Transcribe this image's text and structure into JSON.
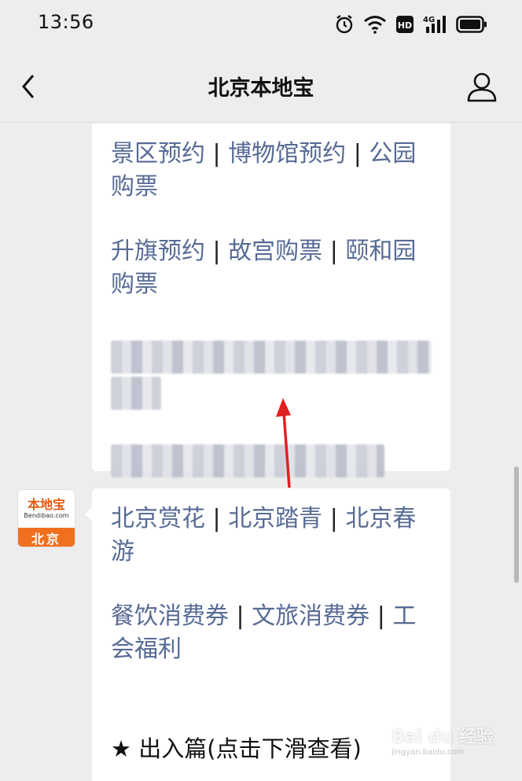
{
  "status_bar": {
    "time": "13:56",
    "network_label": "4G",
    "hd_label": "HD"
  },
  "header": {
    "title": "北京本地宝"
  },
  "message1": {
    "line1": {
      "links": [
        "景区预约",
        "博物馆预约",
        "公园购票"
      ],
      "separator": " | "
    },
    "line2": {
      "links": [
        "升旗预约",
        "故宫购票",
        "颐和园购票"
      ],
      "separator": " | "
    }
  },
  "account": {
    "brand": "本地宝",
    "site": "Bendibao.com",
    "city": "北京"
  },
  "message2": {
    "line1": {
      "links": [
        "北京赏花",
        "北京踏青",
        "北京春游"
      ],
      "separator": " | "
    },
    "line2": {
      "links": [
        "餐饮消费券",
        "文旅消费券",
        "工会福利"
      ],
      "separator": " | "
    },
    "star_text": "★ 出入篇(点击下滑查看)"
  },
  "watermark": {
    "main": "Bai du 经验",
    "sub": "jingyan.baidu.com"
  },
  "colors": {
    "link": "#576b95",
    "background": "#ededed",
    "annotation_arrow": "#e02020"
  }
}
